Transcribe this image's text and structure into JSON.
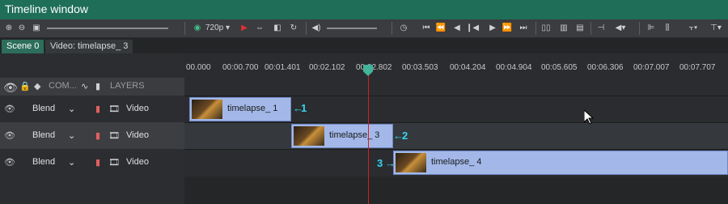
{
  "window": {
    "title": "Timeline window"
  },
  "toolbar": {
    "resolution": "720p"
  },
  "tabs": [
    {
      "label": "Scene 0"
    },
    {
      "label": "Video: timelapse_ 3"
    }
  ],
  "columns": {
    "comp": "COM...",
    "layers": "LAYERS"
  },
  "ruler": {
    "ticks": [
      "00.000",
      "00:00.700",
      "00:01.401",
      "00:02.102",
      "00:02.802",
      "00:03.503",
      "00:04.204",
      "00:04.904",
      "00:05.605",
      "00:06.306",
      "00:07.007",
      "00:07.707"
    ]
  },
  "layers": [
    {
      "blend": "Blend",
      "name": "Video"
    },
    {
      "blend": "Blend",
      "name": "Video"
    },
    {
      "blend": "Blend",
      "name": "Video"
    }
  ],
  "clips": [
    {
      "label": "timelapse_ 1",
      "marker": "1"
    },
    {
      "label": "timelapse_ 3",
      "marker": "2"
    },
    {
      "label": "timelapse_ 4",
      "marker": "3"
    }
  ],
  "colors": {
    "titlebar": "#1f6e57",
    "clip": "#a3b8e8",
    "playhead": "#d02020",
    "marker": "#35d4f0"
  }
}
